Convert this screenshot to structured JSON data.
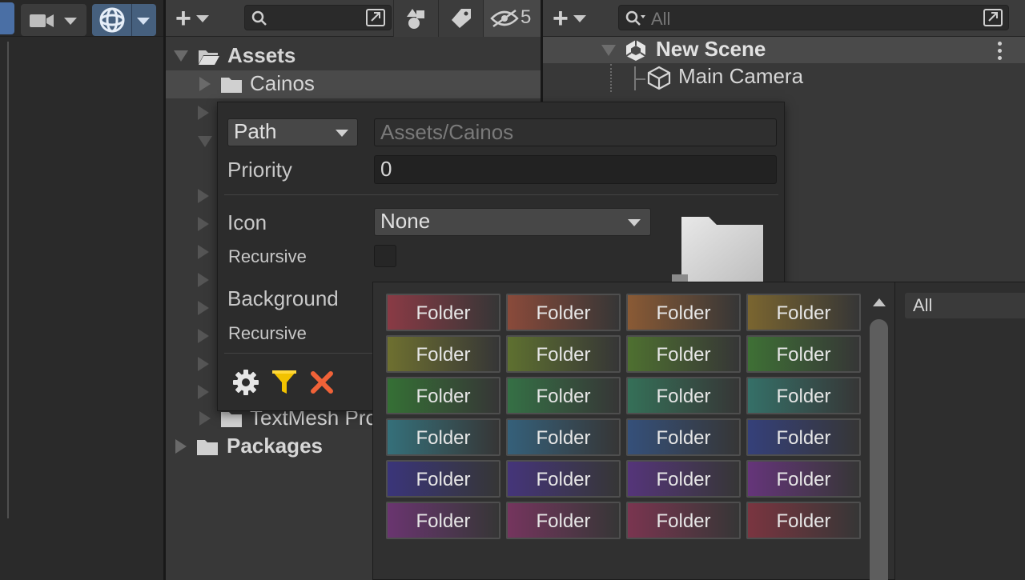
{
  "project": {
    "tree": [
      {
        "label": "Assets",
        "bold": true,
        "expanded": true
      },
      {
        "label": "Cainos",
        "bold": false,
        "expanded": false,
        "selected": true
      },
      {
        "label": "TextMesh Pro",
        "bold": false,
        "expanded": false
      },
      {
        "label": "Packages",
        "bold": true,
        "expanded": false
      }
    ],
    "hidden_count": "5"
  },
  "hierarchy": {
    "search_placeholder": "All",
    "scene_name": "New Scene",
    "camera_label": "Main Camera"
  },
  "folder_settings": {
    "type_dropdown": "Path",
    "path_value": "Assets/Cainos",
    "priority_label": "Priority",
    "priority_value": "0",
    "icon_label": "Icon",
    "icon_value": "None",
    "recursive_label": "Recursive",
    "background_label": "Background",
    "recursive_label_2": "Recursive"
  },
  "palette": {
    "swatch_label": "Folder",
    "colors": [
      "#8a3a45",
      "#8a4a3a",
      "#8a5a35",
      "#7a6530",
      "#6e7030",
      "#5e7030",
      "#4e7030",
      "#3e7035",
      "#357035",
      "#357045",
      "#357058",
      "#357068",
      "#35707a",
      "#35607a",
      "#35507a",
      "#35407a",
      "#3a357a",
      "#45357a",
      "#55357a",
      "#65357a",
      "#6a3570",
      "#75355e",
      "#7a3550",
      "#7a3540"
    ]
  },
  "filter_list": {
    "item": "All"
  }
}
